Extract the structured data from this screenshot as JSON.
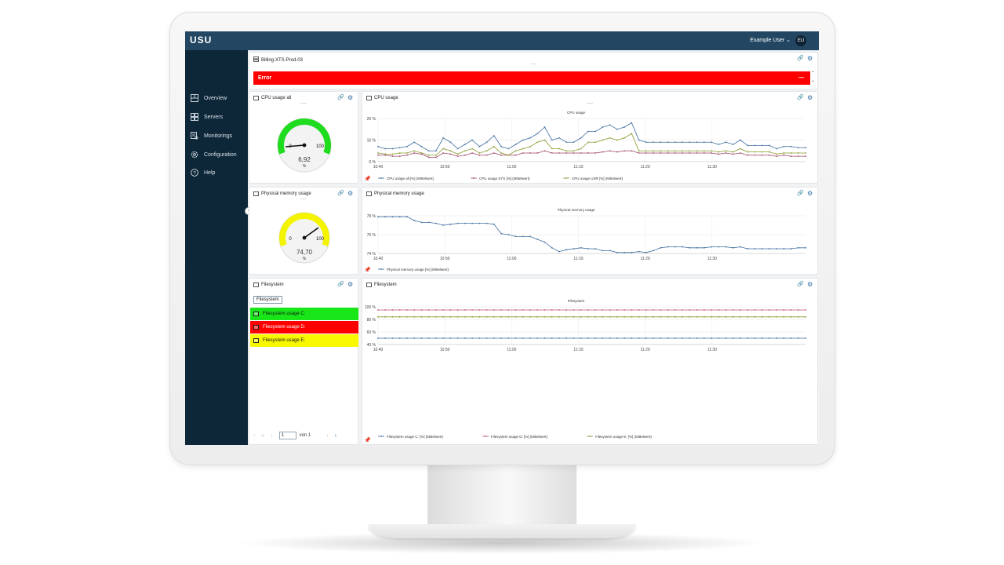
{
  "header": {
    "logo": "USU",
    "user": "Example User",
    "avatar": "EU"
  },
  "sidebar": {
    "items": [
      {
        "label": "Overview",
        "icon": "overview-icon"
      },
      {
        "label": "Servers",
        "icon": "servers-icon"
      },
      {
        "label": "Monitorings",
        "icon": "monitorings-icon"
      },
      {
        "label": "Configuration",
        "icon": "gear-icon"
      },
      {
        "label": "Help",
        "icon": "help-icon"
      }
    ]
  },
  "server_panel": {
    "title": "Billing-XTS-Prod-03",
    "error_label": "Error",
    "minimize_label": "—"
  },
  "cpu_gauge": {
    "title": "CPU usage all",
    "min": "0",
    "max": "100",
    "value": "6,92",
    "unit": "%",
    "value_num": 6.92,
    "color": "#1fdc1f"
  },
  "mem_gauge": {
    "title": "Physical memory usage",
    "min": "0",
    "max": "100",
    "value": "74,70",
    "unit": "%",
    "value_num": 74.7,
    "color": "#f4f400"
  },
  "filesystem": {
    "title": "Filesystem",
    "tag": "Filesystem",
    "rows": [
      {
        "label": "Filesystem usage C:",
        "color": "#19e619",
        "text_color": "#111111"
      },
      {
        "label": "Filesystem usage D:",
        "color": "#ff0000",
        "text_color": "#ffffff"
      },
      {
        "label": "Filesystem usage E:",
        "color": "#f8f800",
        "text_color": "#111111"
      }
    ],
    "pager": {
      "page": "1",
      "of_label": "von 1",
      "first": "«",
      "prev": "‹",
      "prev_outer": "‹",
      "next": "›",
      "next_outer": "›"
    }
  },
  "chart_data": [
    {
      "type": "line",
      "title": "CPU usage",
      "panel_title": "CPU usage",
      "x": [
        "10:40",
        "10:41",
        "10:42",
        "10:43",
        "10:44",
        "10:45",
        "10:46",
        "10:47",
        "10:48",
        "10:49",
        "10:50",
        "10:51",
        "10:52",
        "10:53",
        "10:54",
        "10:55",
        "10:56",
        "10:57",
        "10:58",
        "10:59",
        "11:00",
        "11:01",
        "11:02",
        "11:03",
        "11:04",
        "11:05",
        "11:06",
        "11:07",
        "11:08",
        "11:09",
        "11:10",
        "11:11",
        "11:12",
        "11:13",
        "11:14",
        "11:15",
        "11:16",
        "11:17",
        "11:18",
        "11:19",
        "11:20",
        "11:21",
        "11:22",
        "11:23",
        "11:24",
        "11:25",
        "11:26",
        "11:27",
        "11:28",
        "11:29",
        "11:30",
        "11:31",
        "11:32",
        "11:33",
        "11:34",
        "11:35",
        "11:36",
        "11:37",
        "11:38",
        "11:39"
      ],
      "x_ticks": [
        "10:40",
        "10:50",
        "11:00",
        "11:10",
        "11:20",
        "11:30"
      ],
      "y_ticks": [
        "0 %",
        "10 %",
        "20 %"
      ],
      "ylim": [
        0,
        20
      ],
      "series": [
        {
          "name": "CPU usage all [%] (Mittelwert)",
          "color": "#3f6f9f",
          "values": [
            7,
            6,
            6,
            6.5,
            7,
            9,
            7,
            5,
            5,
            11,
            9,
            6,
            8,
            10,
            7,
            9,
            12,
            7,
            6,
            8,
            10,
            11,
            13,
            16,
            10,
            11,
            9,
            9,
            11,
            14,
            14,
            16,
            17,
            15,
            16,
            18,
            10,
            9,
            9,
            9,
            9,
            9,
            9,
            9,
            9,
            9,
            9,
            8,
            9,
            8,
            10,
            7.5,
            7.5,
            7.5,
            7.5,
            6,
            7,
            7,
            6.5,
            6.5
          ]
        },
        {
          "name": "CPU usage SYS [%] (Mittelwert)",
          "color": "#a0466b",
          "values": [
            3,
            3,
            2.5,
            2.5,
            3,
            4,
            3.5,
            2,
            2,
            4,
            3.5,
            2.5,
            3,
            4,
            3,
            3,
            4,
            3,
            3,
            3,
            4,
            4,
            4,
            5,
            4,
            4,
            4,
            4,
            4,
            4,
            4,
            4.5,
            5,
            4.5,
            5,
            5,
            4,
            4,
            4,
            4,
            4,
            4,
            4,
            4,
            4,
            4,
            4,
            3.5,
            4,
            3.5,
            4,
            3,
            3,
            3,
            3,
            2.5,
            3,
            2.5,
            2.5,
            2.5
          ]
        },
        {
          "name": "CPU usage USR [%] (Mittelwert)",
          "color": "#8a9a2e",
          "values": [
            4,
            3.5,
            3.5,
            4,
            4,
            5,
            4,
            3,
            3,
            6,
            5,
            3.5,
            5,
            6,
            4,
            5,
            7,
            4,
            3,
            5,
            6,
            7,
            9,
            10,
            6,
            6,
            5,
            5,
            6,
            9,
            9,
            10,
            11,
            10,
            11,
            13,
            5,
            5,
            5,
            5,
            5,
            5,
            5,
            5,
            5,
            5,
            5,
            4.5,
            5,
            4.5,
            6,
            4.5,
            4.5,
            4.5,
            4.5,
            3.5,
            4,
            4,
            4,
            4
          ]
        }
      ]
    },
    {
      "type": "line",
      "title": "Physical memory usage",
      "panel_title": "Physical memory usage",
      "x_ticks": [
        "10:40",
        "10:50",
        "11:00",
        "11:10",
        "11:20",
        "11:30"
      ],
      "y_ticks": [
        "74 %",
        "76 %",
        "78 %"
      ],
      "ylim": [
        74,
        78
      ],
      "series": [
        {
          "name": "Physical memory usage [%] (Mittelwert)",
          "color": "#3f6f9f",
          "values": [
            77.9,
            77.9,
            77.9,
            77.9,
            77.9,
            77.5,
            77.3,
            77.3,
            77.2,
            77,
            77.1,
            77.2,
            77.2,
            77.2,
            77.2,
            77.2,
            77.1,
            76.1,
            76,
            75.8,
            75.8,
            75.8,
            75.5,
            75.2,
            74.6,
            74.2,
            74.4,
            74.5,
            74.6,
            74.5,
            74.5,
            74.3,
            74.3,
            74.1,
            74.1,
            74.1,
            74.2,
            74.1,
            74.3,
            74.6,
            74.7,
            74.7,
            74.7,
            74.6,
            74.6,
            74.6,
            74.7,
            74.7,
            74.7,
            74.6,
            74.7,
            74.5,
            74.5,
            74.5,
            74.5,
            74.5,
            74.5,
            74.5,
            74.6,
            74.6
          ]
        }
      ]
    },
    {
      "type": "line",
      "title": "Filesystem",
      "panel_title": "Filesystem",
      "x_ticks": [
        "10:40",
        "10:50",
        "11:00",
        "11:10",
        "11:20",
        "11:30"
      ],
      "y_ticks": [
        "40 %",
        "60 %",
        "80 %",
        "100 %"
      ],
      "ylim": [
        40,
        100
      ],
      "series": [
        {
          "name": "Filesystem usage C: [%] (Mittelwert)",
          "color": "#3f6f9f",
          "values_const": 50
        },
        {
          "name": "Filesystem usage D: [%] (Mittelwert)",
          "color": "#c0506b",
          "values_const": 95
        },
        {
          "name": "Filesystem usage E: [%] (Mittelwert)",
          "color": "#8a9a2e",
          "values_const": 84
        }
      ]
    }
  ]
}
